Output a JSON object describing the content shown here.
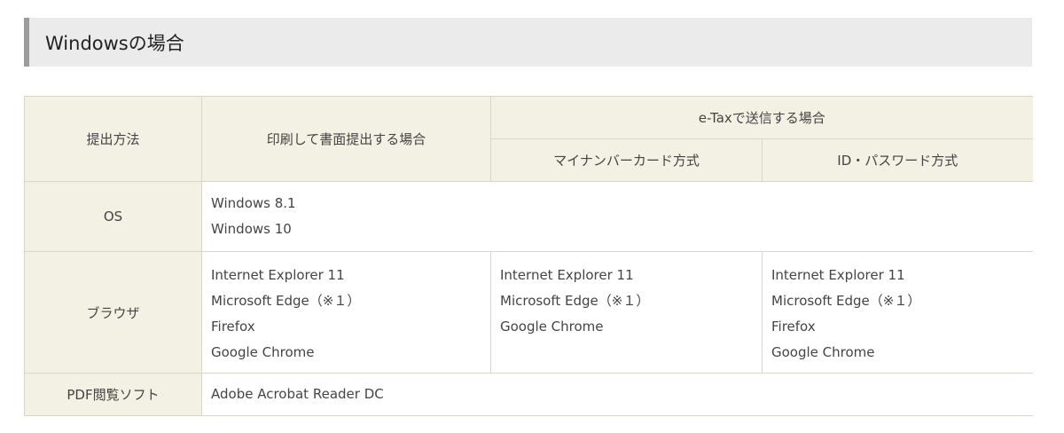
{
  "heading": "Windowsの場合",
  "table": {
    "headers": {
      "method": "提出方法",
      "print": "印刷して書面提出する場合",
      "etax": "e-Taxで送信する場合",
      "mynumber": "マイナンバーカード方式",
      "idpass": "ID・パスワード方式"
    },
    "rows": {
      "os": {
        "label": "OS",
        "items": [
          "Windows 8.1",
          "Windows 10"
        ]
      },
      "browser": {
        "label": "ブラウザ",
        "print": [
          "Internet Explorer 11",
          "Microsoft Edge（※１）",
          "Firefox",
          "Google Chrome"
        ],
        "mynumber": [
          "Internet Explorer 11",
          "Microsoft Edge（※１）",
          "Google Chrome"
        ],
        "idpass": [
          "Internet Explorer 11",
          "Microsoft Edge（※１）",
          "Firefox",
          "Google Chrome"
        ]
      },
      "pdf": {
        "label": "PDF閲覧ソフト",
        "value": "Adobe Acrobat Reader DC"
      }
    }
  }
}
